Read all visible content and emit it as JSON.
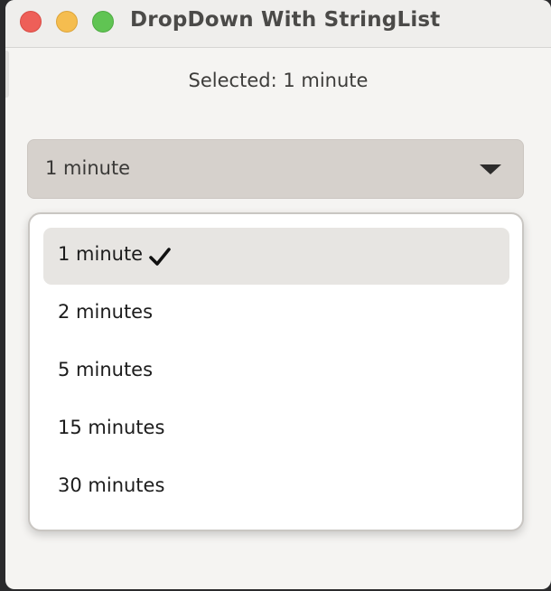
{
  "window": {
    "title": "DropDown With StringList"
  },
  "status": {
    "selected_text": "Selected: 1 minute"
  },
  "dropdown": {
    "current_value": "1 minute",
    "options": [
      {
        "label": "1 minute",
        "selected": true
      },
      {
        "label": "2 minutes",
        "selected": false
      },
      {
        "label": "5 minutes",
        "selected": false
      },
      {
        "label": "15 minutes",
        "selected": false
      },
      {
        "label": "30 minutes",
        "selected": false
      }
    ]
  },
  "icons": {
    "close": "close-icon",
    "minimize": "minimize-icon",
    "maximize": "maximize-icon",
    "dropdown_arrow": "triangle-down-icon",
    "checkmark": "checkmark-icon"
  },
  "colors": {
    "close": "#ee5f58",
    "minimize": "#f5bd4f",
    "maximize": "#60c453",
    "dropdown_bg": "#d6d1cc",
    "selected_option_bg": "#e7e5e2"
  }
}
